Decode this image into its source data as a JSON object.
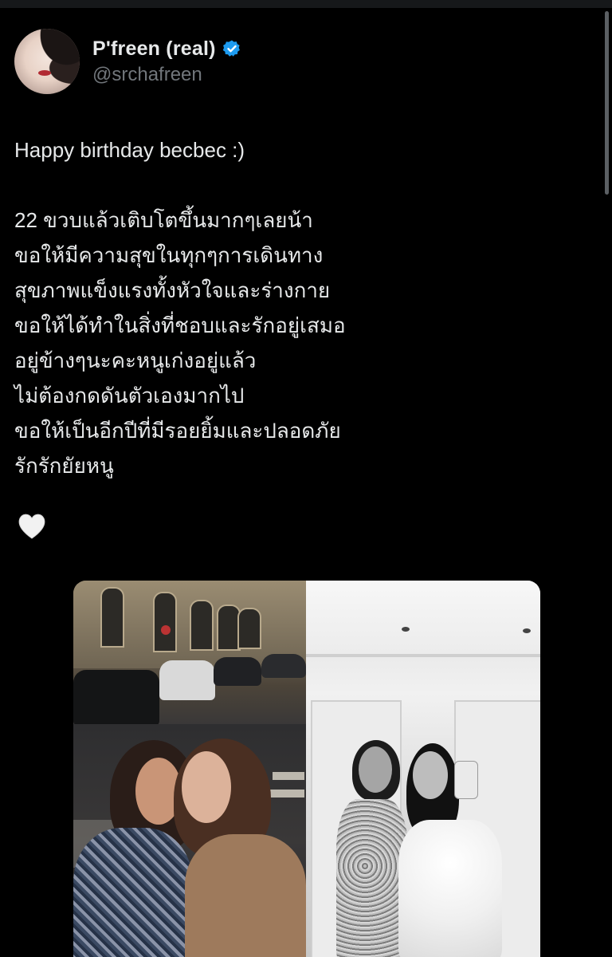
{
  "tweet": {
    "author": {
      "display_name": "P'freen (real)",
      "handle": "@srchafreen",
      "verified": true,
      "verified_color": "#1d9bf0"
    },
    "text_lines": [
      "Happy birthday becbec :)",
      "",
      "22 ขวบแล้วเติบโตขึ้นมากๆเลยน้า",
      "ขอให้มีความสุขในทุกๆการเดินทาง",
      "สุขภาพแข็งแรงทั้งหัวใจและร่างกาย",
      "ขอให้ได้ทำในสิ่งที่ชอบและรักอยู่เสมอ",
      "อยู่ข้างๆนะคะหนูเก่งอยู่แล้ว",
      "ไม่ต้องกดดันตัวเองมากไป",
      "ขอให้เป็นอีกปีที่มีรอยยิ้มและปลอดภัย",
      "รักรักยัยหนู"
    ],
    "emoji": "🤍",
    "media": {
      "count": 2
    }
  },
  "colors": {
    "background": "#000000",
    "text_primary": "#e7e9ea",
    "text_secondary": "#71767b"
  },
  "icons": {
    "verified": "verified-badge-icon",
    "heart": "white-heart-icon"
  }
}
